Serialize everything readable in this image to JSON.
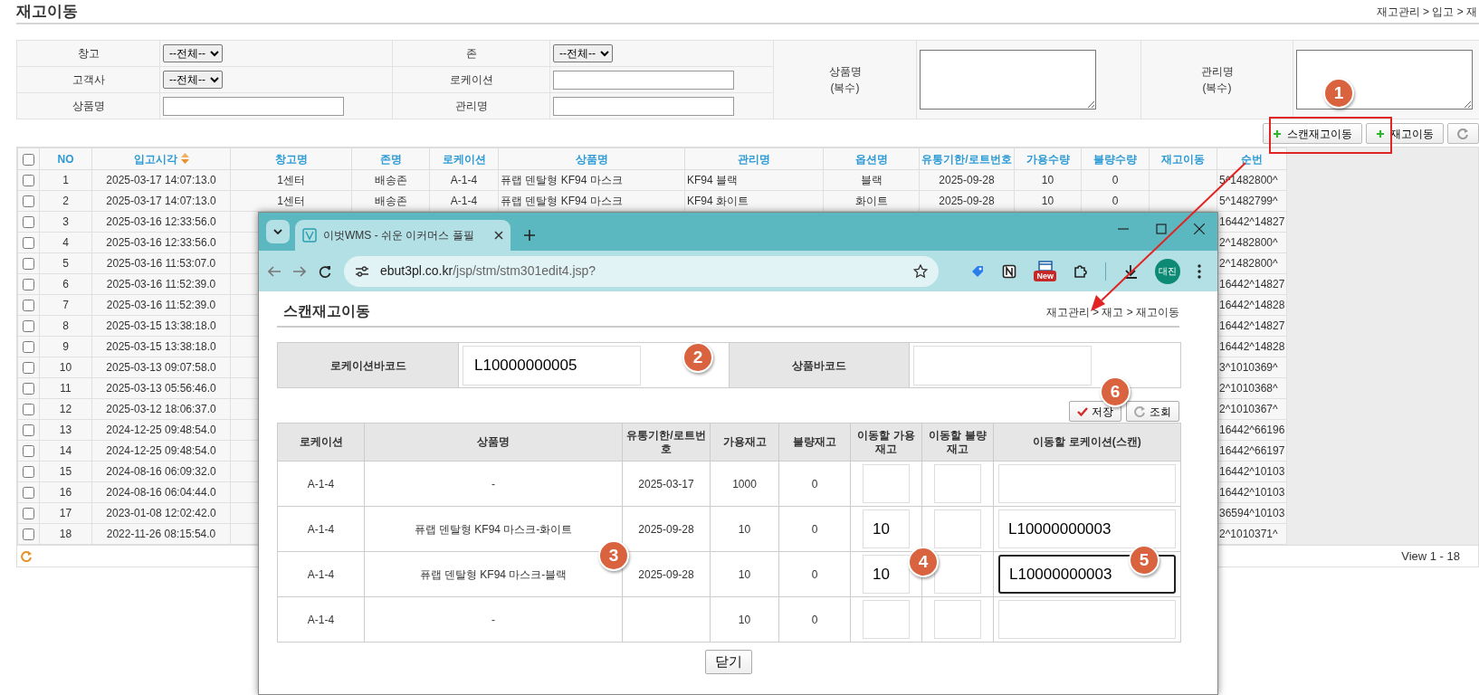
{
  "page": {
    "title": "재고이동",
    "breadcrumb": "재고관리 > 입고 > 재"
  },
  "filters": [
    {
      "label": "창고",
      "kind": "select",
      "value": "--전체--"
    },
    {
      "label": "존",
      "kind": "select",
      "value": "--전체--"
    },
    {
      "label": "고객사",
      "kind": "select",
      "value": "--전체--      "
    },
    {
      "label": "로케이션",
      "kind": "text"
    },
    {
      "label": "상품명",
      "kind": "text"
    },
    {
      "label": "관리명",
      "kind": "text"
    }
  ],
  "multi_filters": [
    {
      "label": "상품명",
      "sublabel": "(복수)"
    },
    {
      "label": "관리명",
      "sublabel": "(복수)"
    }
  ],
  "actions": [
    {
      "label": "스캔재고이동",
      "kind": "add"
    },
    {
      "label": "재고이동",
      "kind": "add"
    },
    {
      "kind": "refresh"
    }
  ],
  "grid": {
    "select_all_checked": false,
    "columns": [
      {
        "label": "NO",
        "sortable": false
      },
      {
        "label": "입고시각",
        "sortable": true
      },
      {
        "label": "창고명",
        "sortable": false
      },
      {
        "label": "존명",
        "sortable": false
      },
      {
        "label": "로케이션",
        "sortable": false
      },
      {
        "label": "상품명",
        "sortable": false
      },
      {
        "label": "관리명",
        "sortable": false
      },
      {
        "label": "옵션명",
        "sortable": false
      },
      {
        "label": "유통기한/로트번호",
        "sortable": false
      },
      {
        "label": "가용수량",
        "sortable": false
      },
      {
        "label": "불량수량",
        "sortable": false
      },
      {
        "label": "재고이동",
        "sortable": false
      },
      {
        "label": "순번",
        "sortable": false
      }
    ],
    "rows": [
      {
        "checked": false,
        "no": "1",
        "received_at": "2025-03-17 14:07:13.0",
        "warehouse": "1센터",
        "zone": "배송존",
        "location": "A-1-4",
        "product": "퓨랩 덴탈형 KF94 마스크",
        "mgmt_name": "KF94 블랙",
        "option": "블랙",
        "expiry": "2025-09-28",
        "available_qty": "10",
        "defect_qty": "0",
        "serial": "5^1482800^"
      },
      {
        "checked": false,
        "no": "2",
        "received_at": "2025-03-17 14:07:13.0",
        "warehouse": "1센터",
        "zone": "배송존",
        "location": "A-1-4",
        "product": "퓨랩 덴탈형 KF94 마스크",
        "mgmt_name": "KF94 화이트",
        "option": "화이트",
        "expiry": "2025-09-28",
        "available_qty": "10",
        "defect_qty": "0",
        "serial": "5^1482799^"
      },
      {
        "checked": false,
        "no": "3",
        "received_at": "2025-03-16 12:33:56.0",
        "serial": "16442^14827"
      },
      {
        "checked": false,
        "no": "4",
        "received_at": "2025-03-16 12:33:56.0",
        "serial": "2^1482800^"
      },
      {
        "checked": false,
        "no": "5",
        "received_at": "2025-03-16 11:53:07.0",
        "serial": "2^1482800^"
      },
      {
        "checked": false,
        "no": "6",
        "received_at": "2025-03-16 11:52:39.0",
        "serial": "16442^14827"
      },
      {
        "checked": false,
        "no": "7",
        "received_at": "2025-03-16 11:52:39.0",
        "serial": "16442^14828"
      },
      {
        "checked": false,
        "no": "8",
        "received_at": "2025-03-15 13:38:18.0",
        "serial": "16442^14827"
      },
      {
        "checked": false,
        "no": "9",
        "received_at": "2025-03-15 13:38:18.0",
        "serial": "16442^14828"
      },
      {
        "checked": false,
        "no": "10",
        "received_at": "2025-03-13 09:07:58.0",
        "serial": "3^1010369^"
      },
      {
        "checked": false,
        "no": "11",
        "received_at": "2025-03-13 05:56:46.0",
        "serial": "2^1010368^"
      },
      {
        "checked": false,
        "no": "12",
        "received_at": "2025-03-12 18:06:37.0",
        "serial": "2^1010367^"
      },
      {
        "checked": false,
        "no": "13",
        "received_at": "2024-12-25 09:48:54.0",
        "serial": "16442^66196"
      },
      {
        "checked": false,
        "no": "14",
        "received_at": "2024-12-25 09:48:54.0",
        "serial": "16442^66197"
      },
      {
        "checked": false,
        "no": "15",
        "received_at": "2024-08-16 06:09:32.0",
        "serial": "16442^10103"
      },
      {
        "checked": false,
        "no": "16",
        "received_at": "2024-08-16 06:04:44.0",
        "serial": "16442^10103"
      },
      {
        "checked": false,
        "no": "17",
        "received_at": "2023-01-08 12:02:42.0",
        "serial": "36594^10103"
      },
      {
        "checked": false,
        "no": "18",
        "received_at": "2022-11-26 08:15:54.0",
        "serial": "2^1010371^"
      }
    ],
    "footer": "View 1 - 18"
  },
  "popup": {
    "window": {
      "tab_title": "이벗WMS - 쉬운 이커머스 풀필",
      "url_domain": "ebut3pl.co.kr",
      "url_path": "/jsp/stm/stm301edit4.jsp?",
      "extension_badge": "New",
      "profile": "대진"
    },
    "title": "스캔재고이동",
    "breadcrumb": "재고관리 > 재고 > 재고이동",
    "scan_fields": [
      {
        "label": "로케이션바코드",
        "value": "L10000000005"
      },
      {
        "label": "상품바코드"
      }
    ],
    "buttons": [
      {
        "label": "저장",
        "kind": "save"
      },
      {
        "label": "조회",
        "kind": "refresh"
      }
    ],
    "table": {
      "columns": [
        "로케이션",
        "상품명",
        "유통기한/로트번호",
        "가용재고",
        "불량재고",
        "이동할 가용재고",
        "이동할 불량재고",
        "이동할 로케이션(스캔)"
      ],
      "rows": [
        {
          "location": "A-1-4",
          "product": "-",
          "expiry": "2025-03-17",
          "available": "1000",
          "defect": "0",
          "focused": false
        },
        {
          "location": "A-1-4",
          "product": "퓨랩 덴탈형 KF94 마스크-화이트",
          "expiry": "2025-09-28",
          "available": "10",
          "defect": "0",
          "move_available": "10",
          "target_location": "L10000000003",
          "focused": false
        },
        {
          "location": "A-1-4",
          "product": "퓨랩 덴탈형 KF94 마스크-블랙",
          "expiry": "2025-09-28",
          "available": "10",
          "defect": "0",
          "move_available": "10",
          "target_location": "L10000000003",
          "focused": true
        },
        {
          "location": "A-1-4",
          "product": "-",
          "available": "10",
          "defect": "0",
          "focused": false
        }
      ]
    },
    "close_button": "닫기"
  },
  "annotations": [
    {
      "label": "1"
    },
    {
      "label": "2"
    },
    {
      "label": "3"
    },
    {
      "label": "4"
    },
    {
      "label": "5"
    },
    {
      "label": "6"
    }
  ]
}
